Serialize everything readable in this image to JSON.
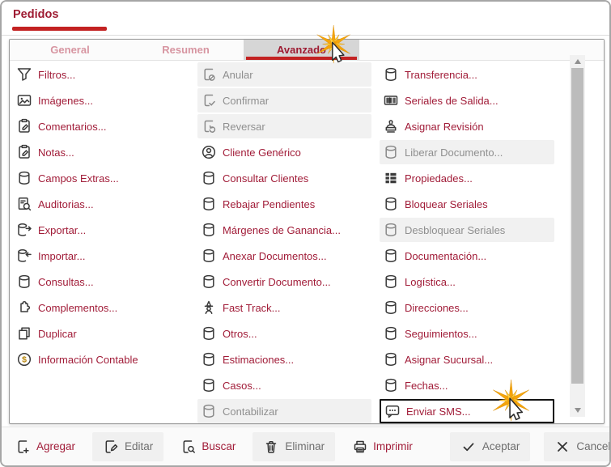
{
  "window": {
    "title": "Pedidos"
  },
  "tabs": [
    {
      "label": "General",
      "active": false
    },
    {
      "label": "Resumen",
      "active": false
    },
    {
      "label": "Avanzado",
      "active": true,
      "cursor": true
    }
  ],
  "menu_columns": [
    {
      "items": [
        {
          "label": "Filtros...",
          "icon": "filter"
        },
        {
          "label": "Imágenes...",
          "icon": "image"
        },
        {
          "label": "Comentarios...",
          "icon": "clipboard-edit"
        },
        {
          "label": "Notas...",
          "icon": "clipboard-edit"
        },
        {
          "label": "Campos Extras...",
          "icon": "database"
        },
        {
          "label": "Auditorias...",
          "icon": "doc-search"
        },
        {
          "label": "Exportar...",
          "icon": "db-export"
        },
        {
          "label": "Importar...",
          "icon": "db-import"
        },
        {
          "label": "Consultas...",
          "icon": "database"
        },
        {
          "label": "Complementos...",
          "icon": "puzzle"
        },
        {
          "label": "Duplicar",
          "icon": "copy"
        },
        {
          "label": "Información Contable",
          "icon": "dollar-circle"
        }
      ]
    },
    {
      "items": [
        {
          "label": "Anular",
          "icon": "doc-cancel",
          "disabled": true
        },
        {
          "label": "Confirmar",
          "icon": "doc-check",
          "disabled": true
        },
        {
          "label": "Reversar",
          "icon": "doc-undo",
          "disabled": true
        },
        {
          "label": "Cliente Genérico",
          "icon": "user-circle"
        },
        {
          "label": "Consultar Clientes",
          "icon": "database"
        },
        {
          "label": "Rebajar Pendientes",
          "icon": "database"
        },
        {
          "label": "Márgenes de Ganancia...",
          "icon": "database"
        },
        {
          "label": "Anexar Documentos...",
          "icon": "database"
        },
        {
          "label": "Convertir Documento...",
          "icon": "database"
        },
        {
          "label": "Fast Track...",
          "icon": "wizard"
        },
        {
          "label": "Otros...",
          "icon": "database"
        },
        {
          "label": "Estimaciones...",
          "icon": "database"
        },
        {
          "label": "Casos...",
          "icon": "database"
        },
        {
          "label": "Contabilizar",
          "icon": "database",
          "disabled": true
        }
      ]
    },
    {
      "items": [
        {
          "label": "Transferencia...",
          "icon": "database"
        },
        {
          "label": "Seriales de Salida...",
          "icon": "barcode"
        },
        {
          "label": "Asignar Revisión",
          "icon": "stamp"
        },
        {
          "label": "Liberar Documento...",
          "icon": "database",
          "disabled": true
        },
        {
          "label": "Propiedades...",
          "icon": "properties"
        },
        {
          "label": "Bloquear Seriales",
          "icon": "database"
        },
        {
          "label": "Desbloquear Seriales",
          "icon": "database",
          "disabled": true
        },
        {
          "label": "Documentación...",
          "icon": "database"
        },
        {
          "label": "Logística...",
          "icon": "database"
        },
        {
          "label": "Direcciones...",
          "icon": "database"
        },
        {
          "label": "Seguimientos...",
          "icon": "database"
        },
        {
          "label": "Asignar Sucursal...",
          "icon": "database"
        },
        {
          "label": "Fechas...",
          "icon": "database"
        },
        {
          "label": "Enviar SMS...",
          "icon": "sms",
          "highlighted": true,
          "cursor": true
        }
      ]
    }
  ],
  "toolbar": {
    "buttons": [
      {
        "label": "Agregar",
        "icon": "doc-plus",
        "style": "link"
      },
      {
        "label": "Editar",
        "icon": "doc-edit",
        "style": "button"
      },
      {
        "label": "Buscar",
        "icon": "doc-search2",
        "style": "link"
      },
      {
        "label": "Eliminar",
        "icon": "trash",
        "style": "button"
      },
      {
        "label": "Imprimir",
        "icon": "printer",
        "style": "link"
      }
    ],
    "collapse_icon": "chevrons-up",
    "actions": [
      {
        "label": "Aceptar",
        "icon": "check",
        "style": "button"
      },
      {
        "label": "Cancelar",
        "icon": "close",
        "style": "button"
      }
    ]
  },
  "colors": {
    "accent_red": "#a11c38",
    "title_red": "#9e1b32",
    "underline_red": "#c32222",
    "tab_inactive_text": "#d795a1",
    "tab_active_bg": "#d6d6d6",
    "disabled_text": "#8f8f8f",
    "disabled_bg": "#f1f1f1",
    "icon_gray": "#3a3a3a",
    "burst_gold": "#f5a50a"
  }
}
